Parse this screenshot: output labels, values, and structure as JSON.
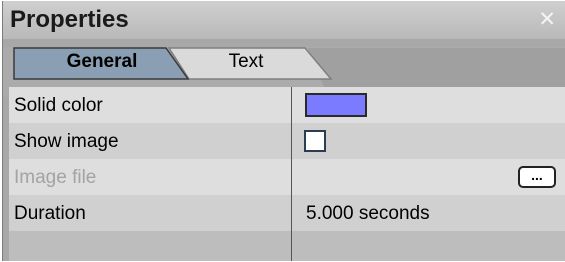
{
  "panel": {
    "title": "Properties"
  },
  "tabs": [
    {
      "label": "General",
      "selected": true
    },
    {
      "label": "Text",
      "selected": false
    }
  ],
  "properties": [
    {
      "name": "Solid color",
      "color": "#7b7bff"
    },
    {
      "name": "Show image",
      "checked": false
    },
    {
      "name": "Image file",
      "disabled": true,
      "button_label": "..."
    },
    {
      "name": "Duration",
      "value": "5.000 seconds"
    },
    {
      "name": "",
      "value": ""
    }
  ],
  "colors": {
    "title_bar": "#c4c4c4",
    "panel_bg": "#a8a8a8",
    "selected_tab": "#8b9fb4",
    "row_light": "#dedede",
    "row_dark": "#d0d0d0",
    "swatch": "#7b7bff"
  }
}
